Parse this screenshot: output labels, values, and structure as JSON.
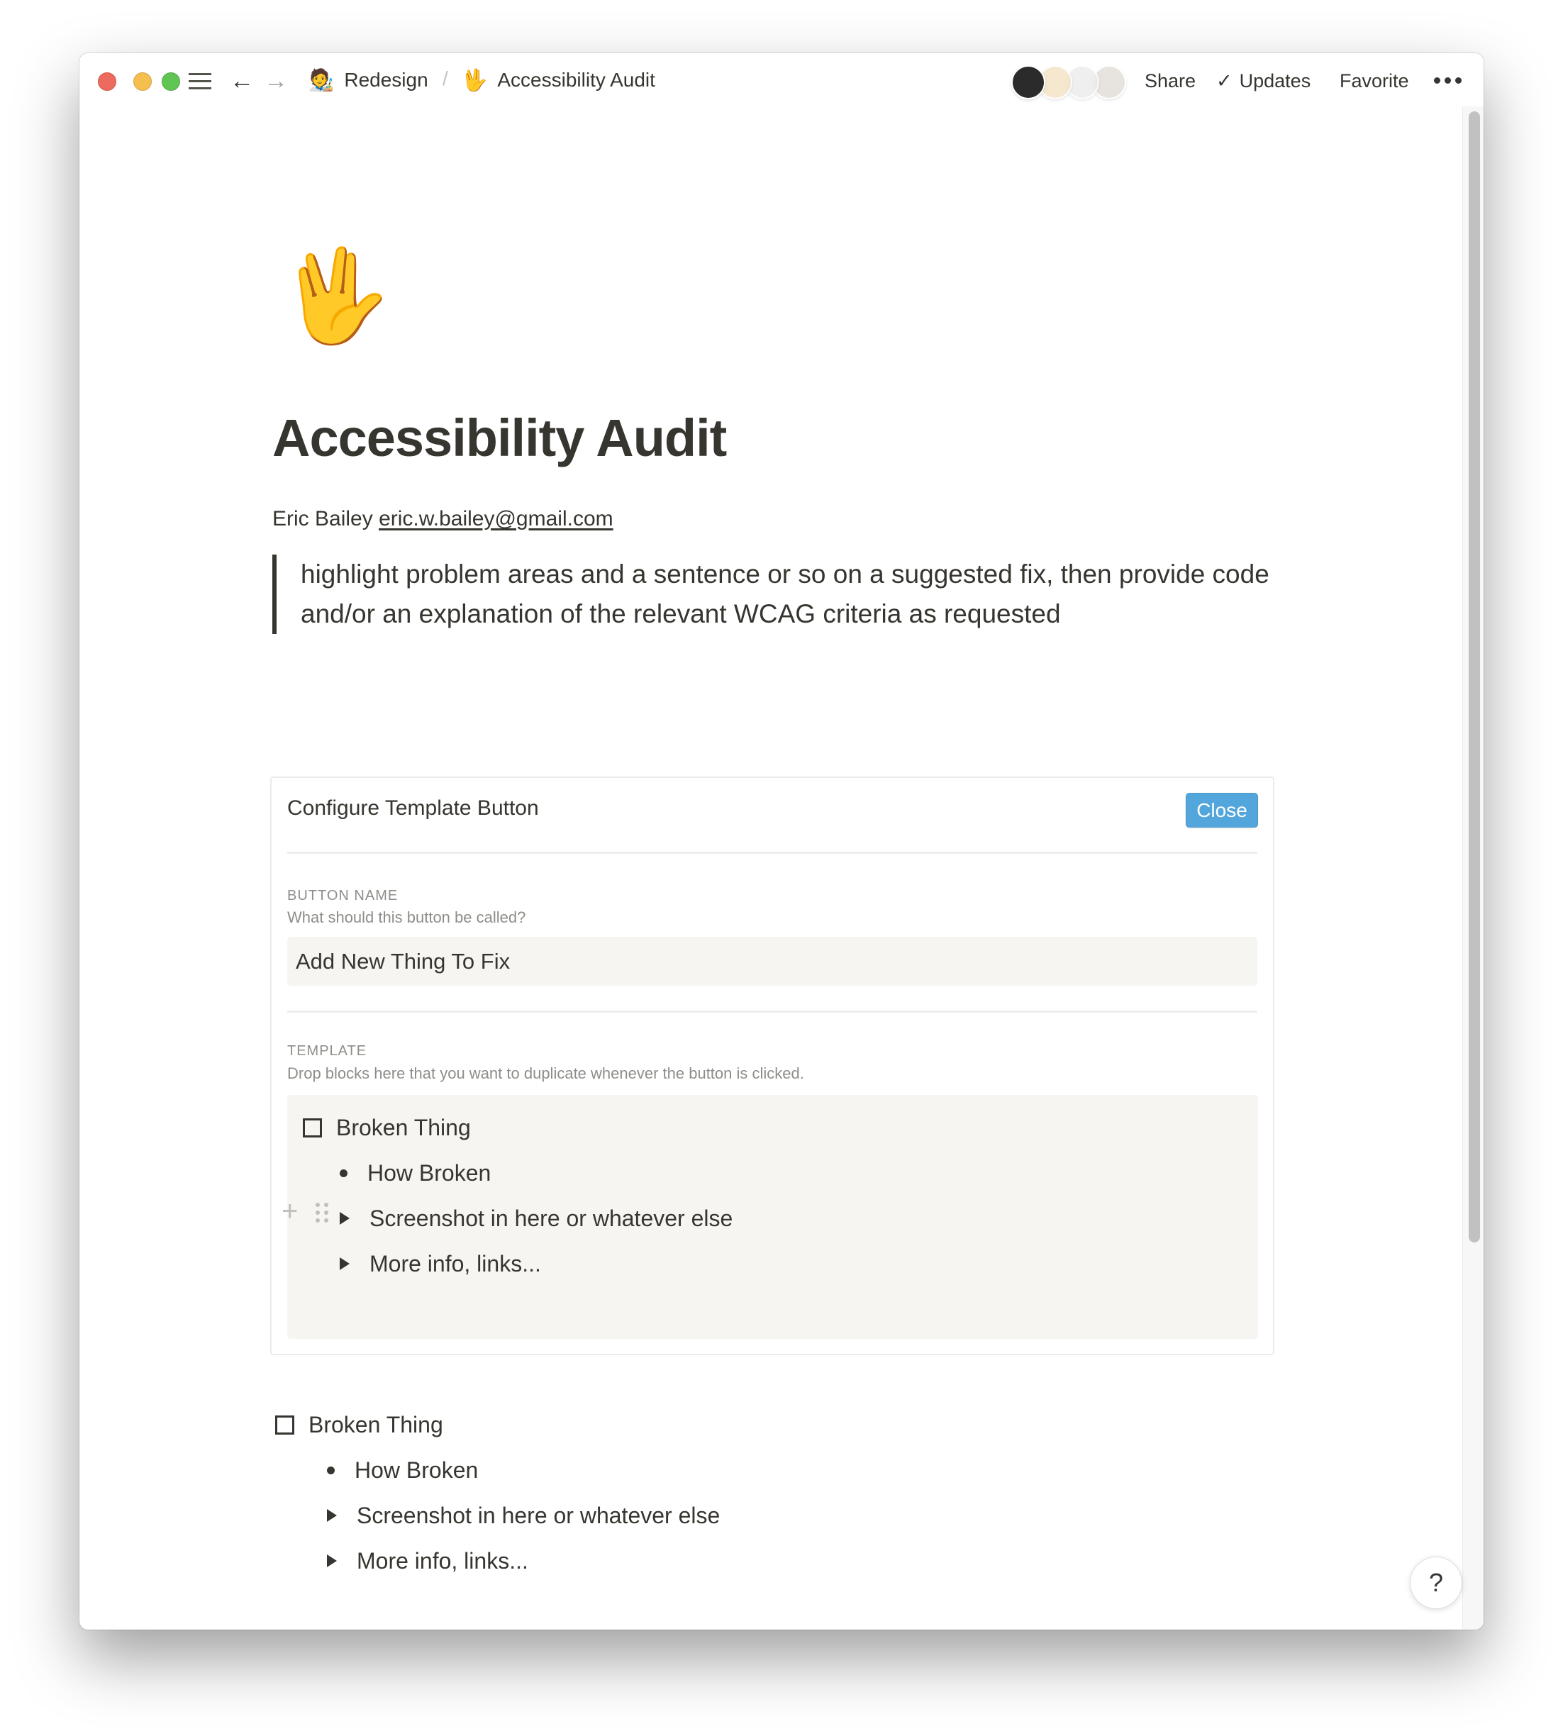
{
  "window": {
    "traffic_lights": [
      "close",
      "minimize",
      "zoom"
    ]
  },
  "topbar": {
    "menu_icon": "hamburger-icon",
    "back_icon": "arrow-left-icon",
    "forward_icon": "arrow-right-icon",
    "breadcrumb": [
      {
        "emoji": "🧑‍🎨",
        "label": "Redesign"
      },
      {
        "emoji": "🖖",
        "label": "Accessibility Audit"
      }
    ],
    "breadcrumb_separator": "/",
    "avatars": [
      {
        "name": "user-1",
        "color": "#2b2b2b"
      },
      {
        "name": "user-2",
        "color": "#f3e3c4"
      },
      {
        "name": "user-3",
        "color": "#e9e9e9"
      },
      {
        "name": "user-4",
        "color": "#e2dcd6"
      }
    ],
    "share_label": "Share",
    "updates_check": "✓",
    "updates_label": "Updates",
    "favorite_label": "Favorite",
    "more_icon": "more-horizontal-icon"
  },
  "page": {
    "icon": "🖖",
    "title": "Accessibility Audit",
    "author_name": "Eric Bailey",
    "author_email": "eric.w.bailey@gmail.com",
    "quote": "highlight problem areas and a sentence or so on a suggested fix, then provide code and/or an explanation of the relevant WCAG criteria as requested"
  },
  "template_button": {
    "plus": "+",
    "label": "Add New Thing To Fix"
  },
  "config_panel": {
    "title": "Configure Template Button",
    "close_label": "Close",
    "close_color": "#52a6db",
    "button_name_label": "BUTTON NAME",
    "button_name_helper": "What should this button be called?",
    "button_name_value": "Add New Thing To Fix",
    "template_label": "TEMPLATE",
    "template_helper": "Drop blocks here that you want to duplicate whenever the button is clicked.",
    "template_blocks": {
      "todo": "Broken Thing",
      "bullet": "How Broken",
      "toggle_1": "Screenshot in here or whatever else",
      "toggle_2": "More info, links..."
    }
  },
  "page_blocks": {
    "todo": "Broken Thing",
    "bullet": "How Broken",
    "toggle_1": "Screenshot in here or whatever else",
    "toggle_2": "More info, links..."
  },
  "help_label": "?"
}
